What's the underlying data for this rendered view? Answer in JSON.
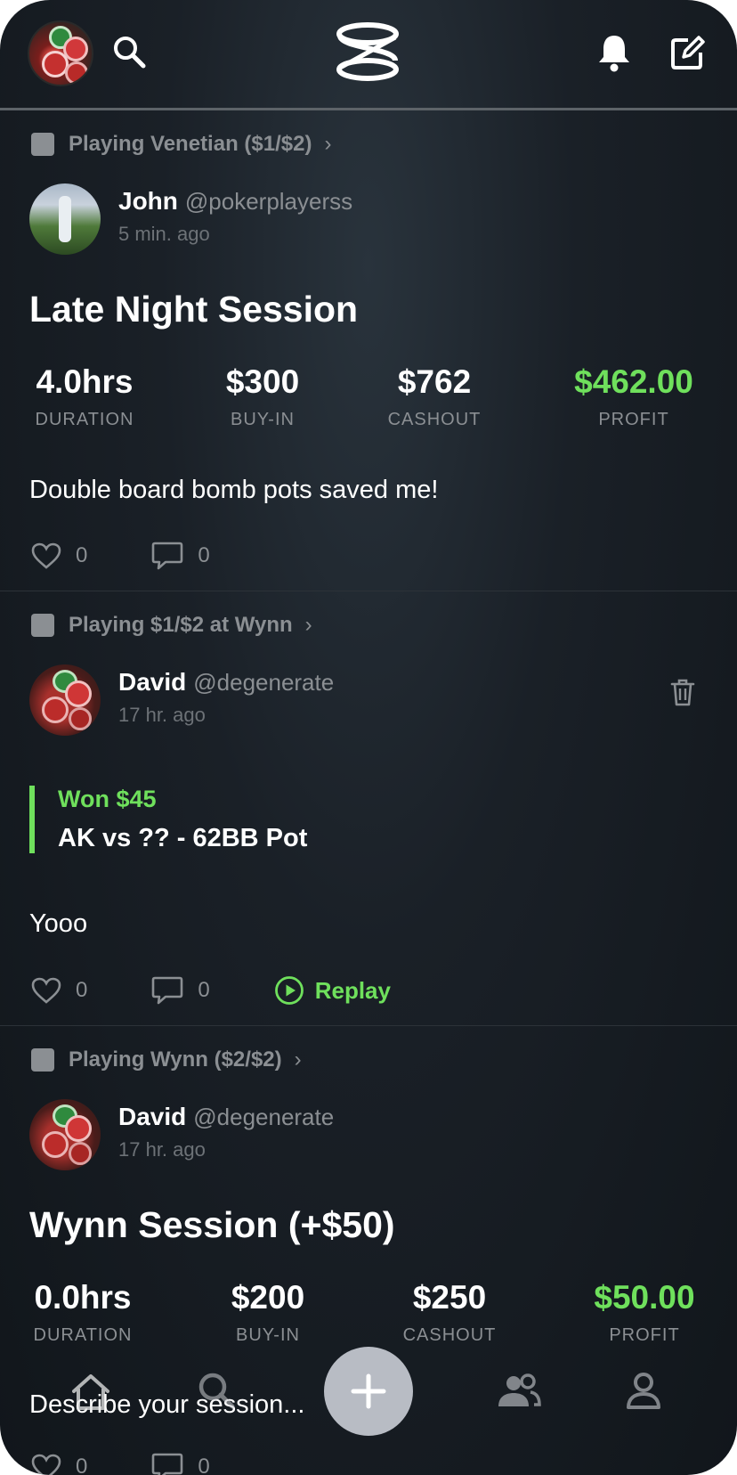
{
  "header": {
    "search_icon": "search-icon",
    "logo": "app-logo",
    "bell_icon": "bell-icon",
    "compose_icon": "compose-icon"
  },
  "posts": [
    {
      "context": "Playing Venetian ($1/$2)",
      "name": "John",
      "handle": "@pokerplayerss",
      "time": "5 min. ago",
      "title": "Late Night Session",
      "stats": [
        {
          "value": "4.0hrs",
          "label": "DURATION"
        },
        {
          "value": "$300",
          "label": "BUY-IN"
        },
        {
          "value": "$762",
          "label": "CASHOUT"
        },
        {
          "value": "$462.00",
          "label": "PROFIT"
        }
      ],
      "body": "Double board bomb pots saved me!",
      "likes": "0",
      "comments": "0"
    },
    {
      "context": "Playing $1/$2 at Wynn",
      "name": "David",
      "handle": "@degenerate",
      "time": "17 hr. ago",
      "hand_result": "Won $45",
      "hand_desc": "AK vs ?? - 62BB Pot",
      "body": "Yooo",
      "likes": "0",
      "comments": "0",
      "replay": "Replay"
    },
    {
      "context": "Playing Wynn ($2/$2)",
      "name": "David",
      "handle": "@degenerate",
      "time": "17 hr. ago",
      "title": "Wynn Session (+$50)",
      "stats": [
        {
          "value": "0.0hrs",
          "label": "DURATION"
        },
        {
          "value": "$200",
          "label": "BUY-IN"
        },
        {
          "value": "$250",
          "label": "CASHOUT"
        },
        {
          "value": "$50.00",
          "label": "PROFIT"
        }
      ],
      "body": "Describe your session...",
      "likes": "0",
      "comments": "0"
    }
  ],
  "colors": {
    "accent_green": "#6fe05c",
    "background": "#11161b",
    "muted_text": "#8b8f93"
  }
}
